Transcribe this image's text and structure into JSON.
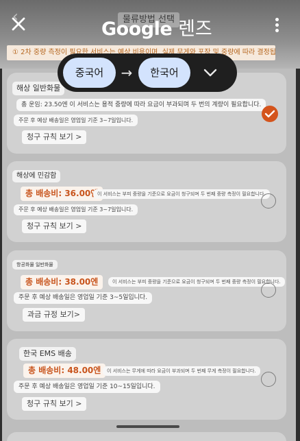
{
  "overlay": {
    "page_title": "물류방법 선택",
    "logo_google": "Google",
    "logo_lens": "렌즈",
    "notice": "① 2차 중량 측정이 필요한 서비스는 예상 비용이며, 실제 무게와 포장 및 중량에 따라 결정됩니다."
  },
  "language": {
    "source": "중국어",
    "target": "한국어",
    "arrow": "→"
  },
  "cards": [
    {
      "title": "해상 일반화물",
      "description": "총 운임: 23.50엔 이 서비스는 용적 중량에 따라 요금이 부과되며 두 번의 계량이 필요합니다.",
      "delivery": "주문 후 예상 배송일은 영업일 기준 3~7일입니다.",
      "rule": "청구 규칙 보기 >",
      "selected": true
    },
    {
      "title": "해상에 민감함",
      "fee": "총 배송비: 36.00엔",
      "note": "이 서비스는 부피 중량을 기준으로 요금이 청구되며 두 번째 중량 측정이 필요합니다.",
      "delivery": "주문 후 예상 배송일은 영업일 기준 3~7일입니다.",
      "rule": "청구 규칙 보기 >",
      "selected": false
    },
    {
      "title": "항공화물 일반화물",
      "fee": "총 배송비: 38.00엔",
      "note": "이 서비스는 부피 중량을 기준으로 요금이 청구되며 두 번째 중량 측정이 필요합니다.",
      "delivery": "주문 후 예상 배송일은 영업일 기준 3~5일입니다.",
      "rule": "과금 규정 보기>",
      "selected": false
    },
    {
      "title": "한국 EMS 배송",
      "fee": "총 배송비: 48.00엔",
      "note": "이 서비스는 무게에 따라 요금이 부과되며 두 번째 무게 측정이 필요합니다.",
      "delivery": "주문 후 예상 배송일은 영업일 기준 10~15일입니다.",
      "rule": "청구 규칙 보기 >",
      "selected": false
    }
  ],
  "colors": {
    "accent": "#d4541c",
    "lang_bar": "#1f1f1f",
    "lang_pill": "#d3e3fd"
  }
}
